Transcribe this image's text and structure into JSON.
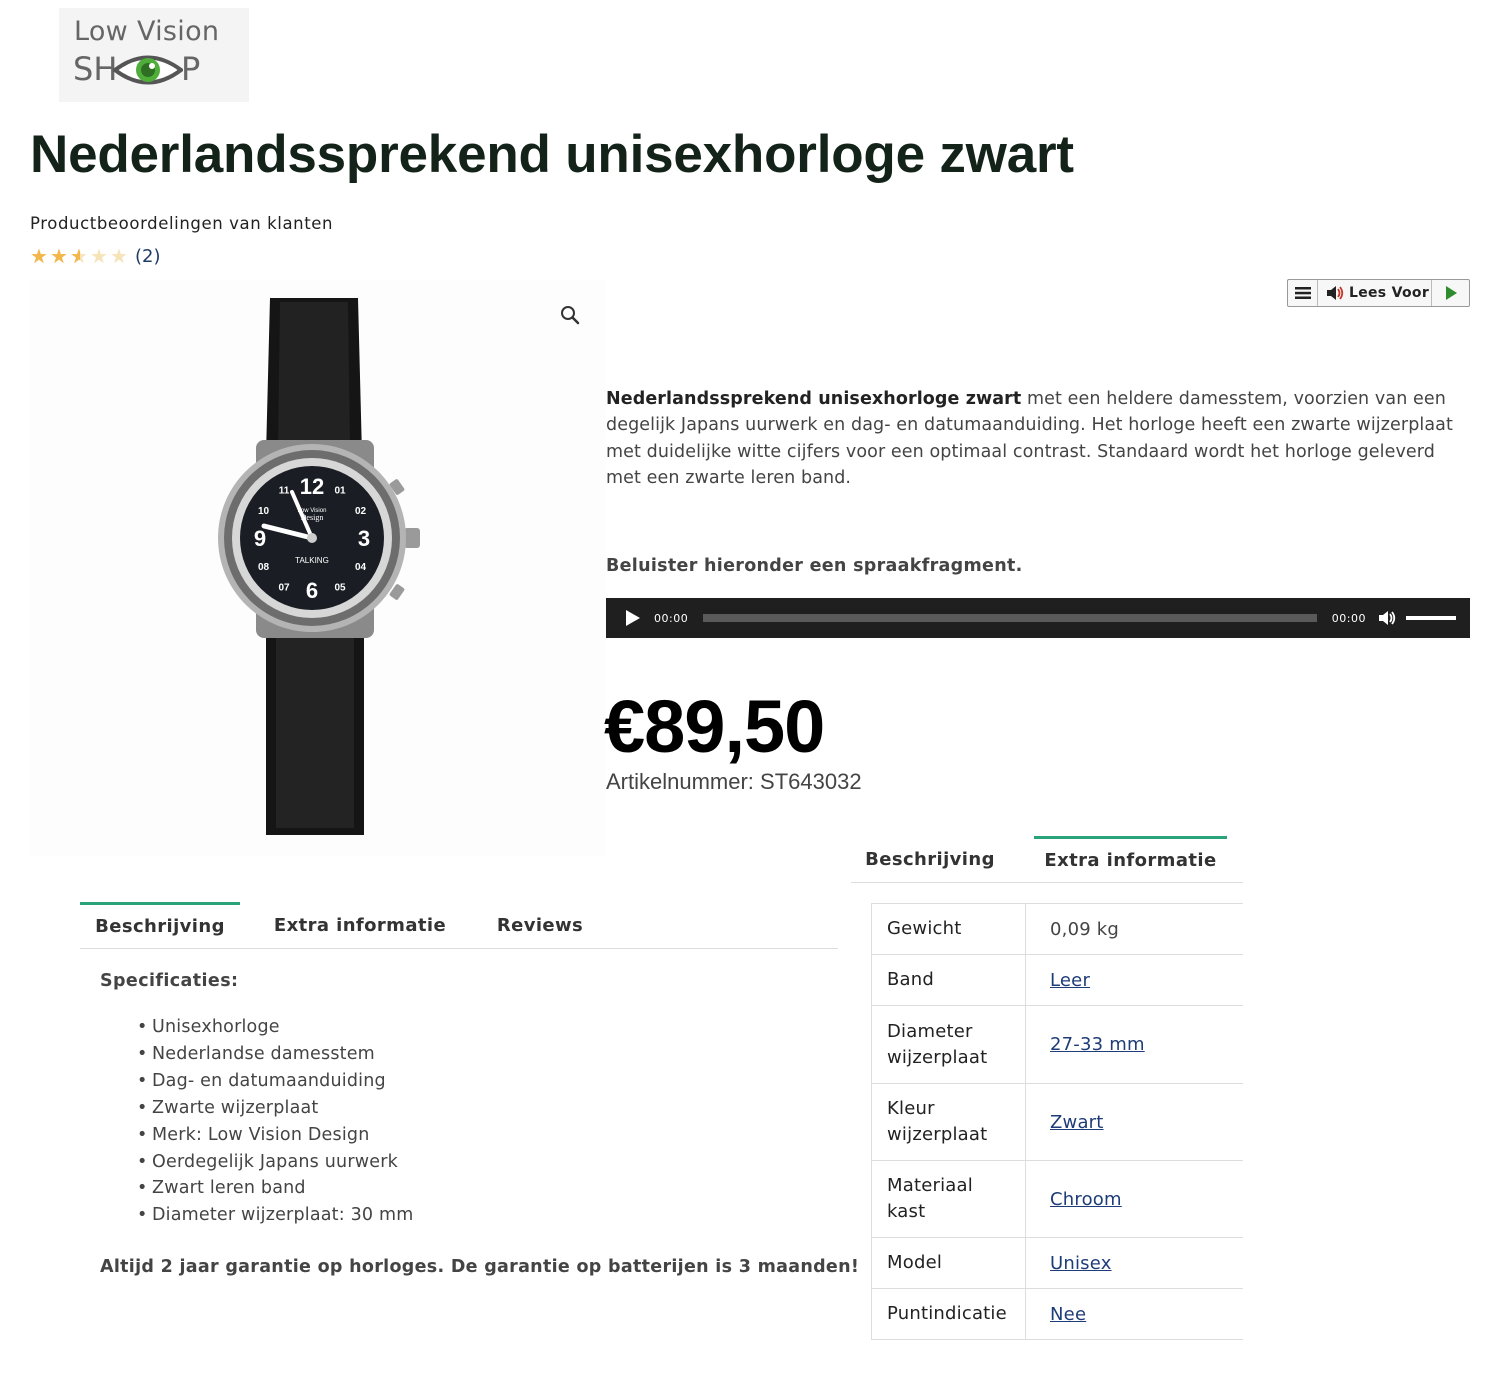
{
  "logo": {
    "line1": "Low Vision",
    "line2_left": "SH",
    "line2_right": "P"
  },
  "product": {
    "title": "Nederlandssprekend unisexhorloge zwart",
    "reviews_label": "Productbeoordelingen van klanten",
    "rating": 2.5,
    "rating_max": 5,
    "review_count": "(2)",
    "price": "€89,50",
    "sku": "Artikelnummer: ST643032"
  },
  "image": {
    "watch_brand_line1": "Low Vision",
    "watch_brand_line2": "Design",
    "watch_label": "TALKING",
    "dial_numbers": [
      "12",
      "01",
      "02",
      "3",
      "04",
      "05",
      "6",
      "07",
      "08",
      "9",
      "10",
      "11"
    ]
  },
  "lees_voor": {
    "label": "Lees Voor"
  },
  "description": {
    "bold": "Nederlandssprekend unisexhorloge zwart",
    "text": " met een heldere damesstem, voorzien van een degelijk Japans uurwerk en dag- en datumaanduiding. Het horloge heeft een zwarte wijzerplaat met duidelijke witte cijfers voor een optimaal contrast. Standaard wordt het horloge geleverd met een zwarte leren band.",
    "listen": "Beluister hieronder een spraakfragment."
  },
  "audio": {
    "current_time": "00:00",
    "duration": "00:00"
  },
  "tabs_right": {
    "items": [
      "Beschrijving",
      "Extra informatie"
    ],
    "active": 1
  },
  "attributes": [
    {
      "key": "Gewicht",
      "value": "0,09 kg",
      "link": false
    },
    {
      "key": "Band",
      "value": "Leer",
      "link": true
    },
    {
      "key": "Diameter wijzerplaat",
      "value": "27-33 mm",
      "link": true
    },
    {
      "key": "Kleur wijzerplaat",
      "value": "Zwart",
      "link": true
    },
    {
      "key": "Materiaal kast",
      "value": "Chroom",
      "link": true
    },
    {
      "key": "Model",
      "value": "Unisex",
      "link": true
    },
    {
      "key": "Puntindicatie",
      "value": "Nee",
      "link": true
    }
  ],
  "tabs_left": {
    "items": [
      "Beschrijving",
      "Extra informatie",
      "Reviews"
    ],
    "active": 0
  },
  "specs": {
    "title": "Specificaties:",
    "items": [
      "Unisexhorloge",
      "Nederlandse damesstem",
      "Dag- en datumaanduiding",
      "Zwarte wijzerplaat",
      "Merk: Low Vision Design",
      "Oerdegelijk Japans uurwerk",
      "Zwart leren band",
      "Diameter wijzerplaat: 30 mm"
    ],
    "warranty": "Altijd 2 jaar garantie op horloges. De garantie op batterijen is 3 maanden!"
  },
  "colors": {
    "accent": "#2aa37a",
    "link": "#1e3c78",
    "title": "#14231a",
    "star": "#f2b74a"
  },
  "icons": {
    "zoom": "magnifier-icon",
    "menu": "hamburger-icon",
    "speaker": "speaker-icon",
    "play": "play-icon",
    "mute": "volume-icon"
  }
}
